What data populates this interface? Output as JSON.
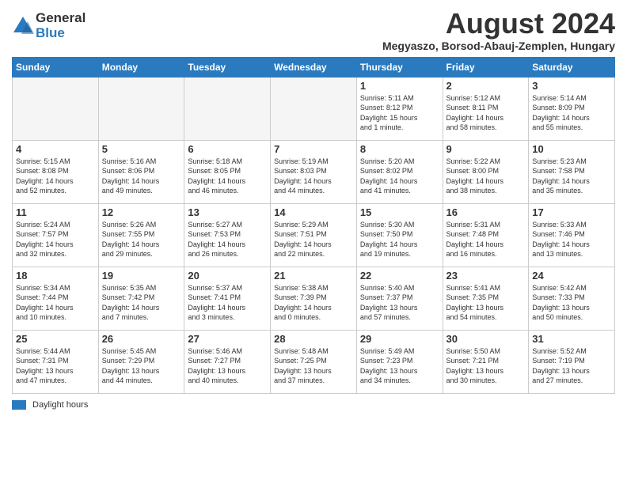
{
  "logo": {
    "general": "General",
    "blue": "Blue"
  },
  "title": "August 2024",
  "location": "Megyaszo, Borsod-Abauj-Zemplen, Hungary",
  "headers": [
    "Sunday",
    "Monday",
    "Tuesday",
    "Wednesday",
    "Thursday",
    "Friday",
    "Saturday"
  ],
  "footer": {
    "label": "Daylight hours"
  },
  "weeks": [
    [
      {
        "day": "",
        "info": ""
      },
      {
        "day": "",
        "info": ""
      },
      {
        "day": "",
        "info": ""
      },
      {
        "day": "",
        "info": ""
      },
      {
        "day": "1",
        "info": "Sunrise: 5:11 AM\nSunset: 8:12 PM\nDaylight: 15 hours\nand 1 minute."
      },
      {
        "day": "2",
        "info": "Sunrise: 5:12 AM\nSunset: 8:11 PM\nDaylight: 14 hours\nand 58 minutes."
      },
      {
        "day": "3",
        "info": "Sunrise: 5:14 AM\nSunset: 8:09 PM\nDaylight: 14 hours\nand 55 minutes."
      }
    ],
    [
      {
        "day": "4",
        "info": "Sunrise: 5:15 AM\nSunset: 8:08 PM\nDaylight: 14 hours\nand 52 minutes."
      },
      {
        "day": "5",
        "info": "Sunrise: 5:16 AM\nSunset: 8:06 PM\nDaylight: 14 hours\nand 49 minutes."
      },
      {
        "day": "6",
        "info": "Sunrise: 5:18 AM\nSunset: 8:05 PM\nDaylight: 14 hours\nand 46 minutes."
      },
      {
        "day": "7",
        "info": "Sunrise: 5:19 AM\nSunset: 8:03 PM\nDaylight: 14 hours\nand 44 minutes."
      },
      {
        "day": "8",
        "info": "Sunrise: 5:20 AM\nSunset: 8:02 PM\nDaylight: 14 hours\nand 41 minutes."
      },
      {
        "day": "9",
        "info": "Sunrise: 5:22 AM\nSunset: 8:00 PM\nDaylight: 14 hours\nand 38 minutes."
      },
      {
        "day": "10",
        "info": "Sunrise: 5:23 AM\nSunset: 7:58 PM\nDaylight: 14 hours\nand 35 minutes."
      }
    ],
    [
      {
        "day": "11",
        "info": "Sunrise: 5:24 AM\nSunset: 7:57 PM\nDaylight: 14 hours\nand 32 minutes."
      },
      {
        "day": "12",
        "info": "Sunrise: 5:26 AM\nSunset: 7:55 PM\nDaylight: 14 hours\nand 29 minutes."
      },
      {
        "day": "13",
        "info": "Sunrise: 5:27 AM\nSunset: 7:53 PM\nDaylight: 14 hours\nand 26 minutes."
      },
      {
        "day": "14",
        "info": "Sunrise: 5:29 AM\nSunset: 7:51 PM\nDaylight: 14 hours\nand 22 minutes."
      },
      {
        "day": "15",
        "info": "Sunrise: 5:30 AM\nSunset: 7:50 PM\nDaylight: 14 hours\nand 19 minutes."
      },
      {
        "day": "16",
        "info": "Sunrise: 5:31 AM\nSunset: 7:48 PM\nDaylight: 14 hours\nand 16 minutes."
      },
      {
        "day": "17",
        "info": "Sunrise: 5:33 AM\nSunset: 7:46 PM\nDaylight: 14 hours\nand 13 minutes."
      }
    ],
    [
      {
        "day": "18",
        "info": "Sunrise: 5:34 AM\nSunset: 7:44 PM\nDaylight: 14 hours\nand 10 minutes."
      },
      {
        "day": "19",
        "info": "Sunrise: 5:35 AM\nSunset: 7:42 PM\nDaylight: 14 hours\nand 7 minutes."
      },
      {
        "day": "20",
        "info": "Sunrise: 5:37 AM\nSunset: 7:41 PM\nDaylight: 14 hours\nand 3 minutes."
      },
      {
        "day": "21",
        "info": "Sunrise: 5:38 AM\nSunset: 7:39 PM\nDaylight: 14 hours\nand 0 minutes."
      },
      {
        "day": "22",
        "info": "Sunrise: 5:40 AM\nSunset: 7:37 PM\nDaylight: 13 hours\nand 57 minutes."
      },
      {
        "day": "23",
        "info": "Sunrise: 5:41 AM\nSunset: 7:35 PM\nDaylight: 13 hours\nand 54 minutes."
      },
      {
        "day": "24",
        "info": "Sunrise: 5:42 AM\nSunset: 7:33 PM\nDaylight: 13 hours\nand 50 minutes."
      }
    ],
    [
      {
        "day": "25",
        "info": "Sunrise: 5:44 AM\nSunset: 7:31 PM\nDaylight: 13 hours\nand 47 minutes."
      },
      {
        "day": "26",
        "info": "Sunrise: 5:45 AM\nSunset: 7:29 PM\nDaylight: 13 hours\nand 44 minutes."
      },
      {
        "day": "27",
        "info": "Sunrise: 5:46 AM\nSunset: 7:27 PM\nDaylight: 13 hours\nand 40 minutes."
      },
      {
        "day": "28",
        "info": "Sunrise: 5:48 AM\nSunset: 7:25 PM\nDaylight: 13 hours\nand 37 minutes."
      },
      {
        "day": "29",
        "info": "Sunrise: 5:49 AM\nSunset: 7:23 PM\nDaylight: 13 hours\nand 34 minutes."
      },
      {
        "day": "30",
        "info": "Sunrise: 5:50 AM\nSunset: 7:21 PM\nDaylight: 13 hours\nand 30 minutes."
      },
      {
        "day": "31",
        "info": "Sunrise: 5:52 AM\nSunset: 7:19 PM\nDaylight: 13 hours\nand 27 minutes."
      }
    ]
  ]
}
